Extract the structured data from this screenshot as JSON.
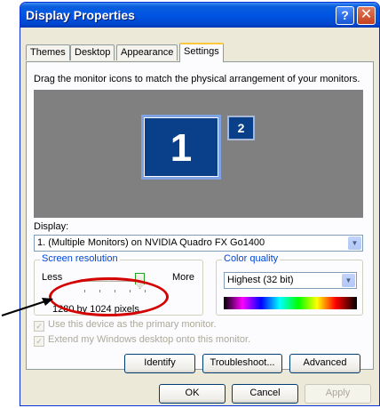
{
  "window": {
    "title": "Display Properties"
  },
  "titlebar": {
    "help_label": "?",
    "close_label": "✕"
  },
  "tabs": [
    {
      "label": "Themes"
    },
    {
      "label": "Desktop"
    },
    {
      "label": "Appearance"
    },
    {
      "label": "Settings"
    }
  ],
  "settings": {
    "instruction": "Drag the monitor icons to match the physical arrangement of your monitors.",
    "monitors": [
      {
        "label": "1"
      },
      {
        "label": "2"
      }
    ],
    "display_label": "Display:",
    "display_value": "1. (Multiple Monitors) on NVIDIA Quadro FX Go1400",
    "screen_resolution": {
      "legend": "Screen resolution",
      "less_label": "Less",
      "more_label": "More",
      "value_text": "1280 by 1024 pixels"
    },
    "color_quality": {
      "legend": "Color quality",
      "selected": "Highest (32 bit)"
    },
    "primary_monitor_label": "Use this device as the primary monitor.",
    "extend_label": "Extend my Windows desktop onto this monitor.",
    "buttons": {
      "identify": "Identify",
      "troubleshoot": "Troubleshoot...",
      "advanced": "Advanced"
    }
  },
  "footer": {
    "ok": "OK",
    "cancel": "Cancel",
    "apply": "Apply"
  },
  "colors": {
    "titlebar": "#0054e3",
    "annotation": "#d40000",
    "monitor_bg": "#808080"
  }
}
